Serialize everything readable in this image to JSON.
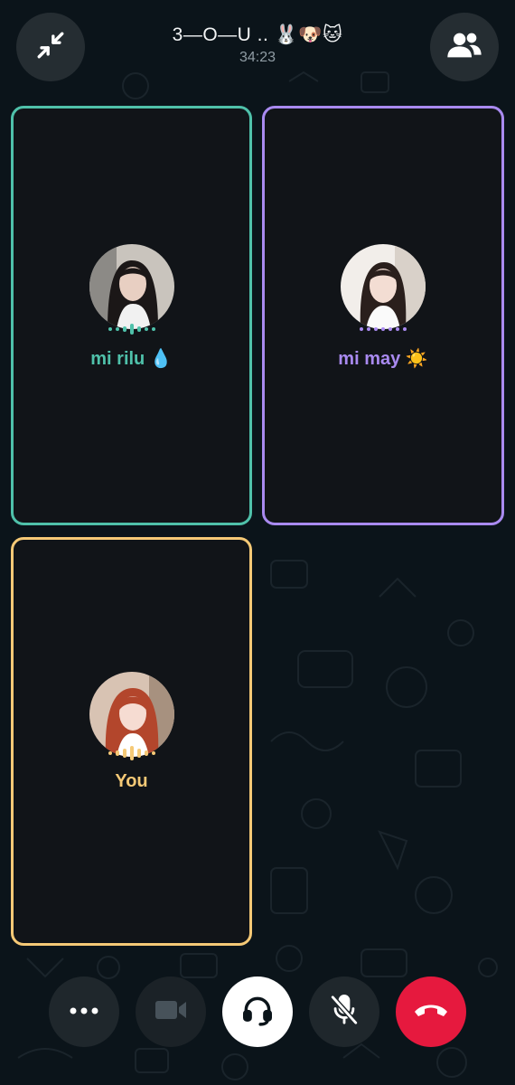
{
  "call": {
    "title": "3—O—U .. 🐰🐶🐱",
    "timer": "34:23"
  },
  "participants": [
    {
      "name": "mi rilu 💧",
      "accent": "#4fc1aa"
    },
    {
      "name": "mi may ☀️",
      "accent": "#a98af0"
    },
    {
      "name": "You",
      "accent": "#f5c976"
    }
  ],
  "controls": {
    "more_icon": "more-icon",
    "video_icon": "video-camera-icon",
    "audio_icon": "headphones-icon",
    "mute_icon": "mic-muted-icon",
    "end_icon": "end-call-icon",
    "end_color": "#e6193e"
  },
  "top_buttons": {
    "minimize_icon": "minimize-icon",
    "participants_icon": "participants-icon"
  }
}
